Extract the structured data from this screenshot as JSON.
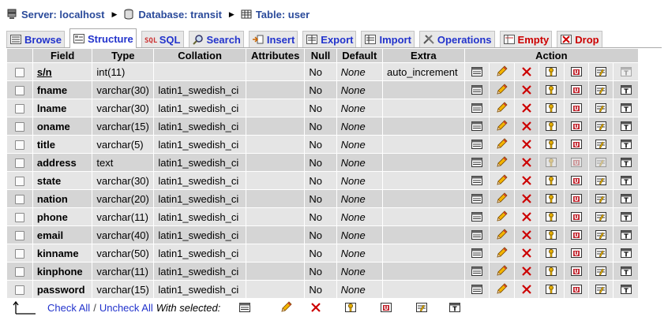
{
  "breadcrumb": {
    "server": "Server: localhost",
    "database": "Database: transit",
    "table": "Table: user"
  },
  "tabs": [
    {
      "label": "Browse",
      "icon": "browse-icon"
    },
    {
      "label": "Structure",
      "icon": "structure-icon",
      "active": true
    },
    {
      "label": "SQL",
      "icon": "sql-icon"
    },
    {
      "label": "Search",
      "icon": "search-icon"
    },
    {
      "label": "Insert",
      "icon": "insert-icon"
    },
    {
      "label": "Export",
      "icon": "export-icon"
    },
    {
      "label": "Import",
      "icon": "import-icon"
    },
    {
      "label": "Operations",
      "icon": "operations-icon"
    },
    {
      "label": "Empty",
      "icon": "empty-icon"
    },
    {
      "label": "Drop",
      "icon": "drop-icon"
    }
  ],
  "columns": {
    "field": "Field",
    "type": "Type",
    "collation": "Collation",
    "attributes": "Attributes",
    "null": "Null",
    "default": "Default",
    "extra": "Extra",
    "action": "Action"
  },
  "rows": [
    {
      "field": "s/n",
      "type": "int(11)",
      "collation": "",
      "attributes": "",
      "null": "No",
      "default": "None",
      "extra": "auto_increment",
      "primary": true
    },
    {
      "field": "fname",
      "type": "varchar(30)",
      "collation": "latin1_swedish_ci",
      "attributes": "",
      "null": "No",
      "default": "None",
      "extra": ""
    },
    {
      "field": "lname",
      "type": "varchar(30)",
      "collation": "latin1_swedish_ci",
      "attributes": "",
      "null": "No",
      "default": "None",
      "extra": ""
    },
    {
      "field": "oname",
      "type": "varchar(15)",
      "collation": "latin1_swedish_ci",
      "attributes": "",
      "null": "No",
      "default": "None",
      "extra": ""
    },
    {
      "field": "title",
      "type": "varchar(5)",
      "collation": "latin1_swedish_ci",
      "attributes": "",
      "null": "No",
      "default": "None",
      "extra": ""
    },
    {
      "field": "address",
      "type": "text",
      "collation": "latin1_swedish_ci",
      "attributes": "",
      "null": "No",
      "default": "None",
      "extra": "",
      "text_type": true
    },
    {
      "field": "state",
      "type": "varchar(30)",
      "collation": "latin1_swedish_ci",
      "attributes": "",
      "null": "No",
      "default": "None",
      "extra": ""
    },
    {
      "field": "nation",
      "type": "varchar(20)",
      "collation": "latin1_swedish_ci",
      "attributes": "",
      "null": "No",
      "default": "None",
      "extra": ""
    },
    {
      "field": "phone",
      "type": "varchar(11)",
      "collation": "latin1_swedish_ci",
      "attributes": "",
      "null": "No",
      "default": "None",
      "extra": ""
    },
    {
      "field": "email",
      "type": "varchar(40)",
      "collation": "latin1_swedish_ci",
      "attributes": "",
      "null": "No",
      "default": "None",
      "extra": ""
    },
    {
      "field": "kinname",
      "type": "varchar(50)",
      "collation": "latin1_swedish_ci",
      "attributes": "",
      "null": "No",
      "default": "None",
      "extra": ""
    },
    {
      "field": "kinphone",
      "type": "varchar(11)",
      "collation": "latin1_swedish_ci",
      "attributes": "",
      "null": "No",
      "default": "None",
      "extra": ""
    },
    {
      "field": "password",
      "type": "varchar(15)",
      "collation": "latin1_swedish_ci",
      "attributes": "",
      "null": "No",
      "default": "None",
      "extra": ""
    }
  ],
  "action_icons": [
    "browse-distinct-icon",
    "edit-icon",
    "drop-icon",
    "primary-key-icon",
    "unique-icon",
    "index-icon",
    "fulltext-icon"
  ],
  "footer": {
    "check_all": "Check All",
    "separator": "/",
    "uncheck_all": "Uncheck All",
    "with_selected": "With selected:"
  },
  "colors": {
    "link": "#2233cc",
    "breadcrumb": "#2a4a9a",
    "danger": "#cc0000",
    "header_bg": "#d0d0d0",
    "row_odd": "#e5e5e5",
    "row_even": "#d5d5d5"
  }
}
